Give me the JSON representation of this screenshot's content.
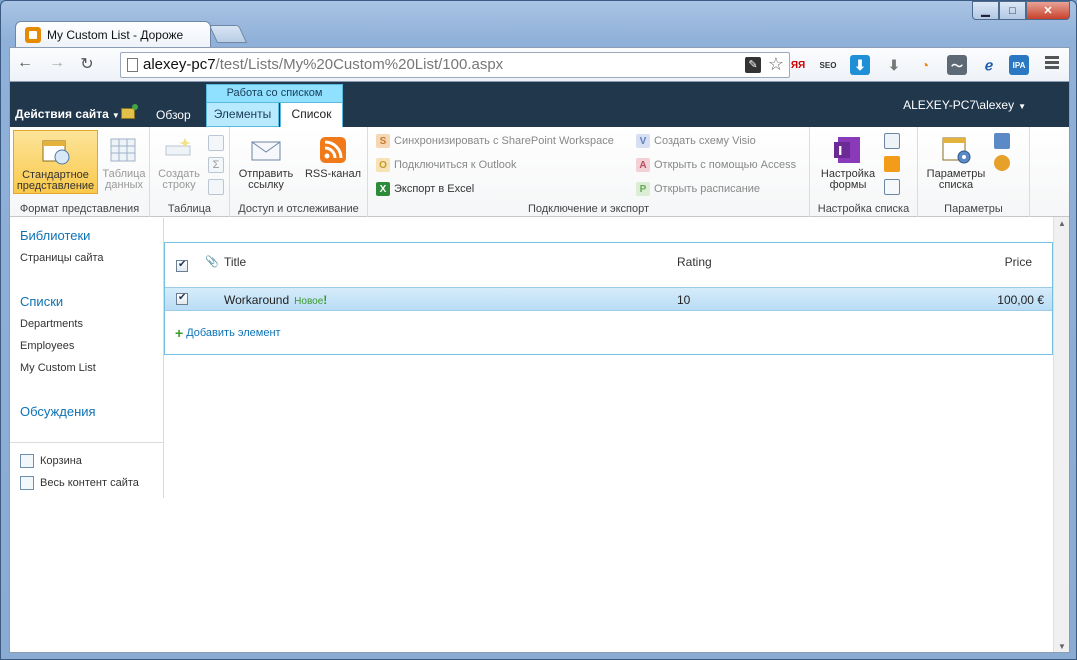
{
  "browser": {
    "tab_title": "My Custom List - Дороже",
    "url_host": "alexey-pc7",
    "url_path": "/test/Lists/My%20Custom%20List/100.aspx",
    "win_minimize": "▁",
    "win_maximize": "□",
    "win_close": "✕",
    "back": "←",
    "forward": "→",
    "reload": "↻",
    "ext_yandex": "ЯЯ",
    "ext_seo": "SEO",
    "ext_ipa": "IPA"
  },
  "topbar": {
    "site_actions": "Действия сайта",
    "browse_tab": "Обзор",
    "context_group": "Работа со списком",
    "tab_items": "Элементы",
    "tab_list": "Список",
    "user": "ALEXEY-PC7\\alexey"
  },
  "ribbon": {
    "groups": {
      "view_format": "Формат представления",
      "datasheet": "Таблица",
      "share_track": "Доступ и отслеживание",
      "connect_export": "Подключение и экспорт",
      "customize_list": "Настройка списка",
      "settings": "Параметры"
    },
    "buttons": {
      "standard_view": "Стандартное\nпредставление",
      "datasheet_view": "Таблица\nданных",
      "create_row": "Создать\nстроку",
      "email_link": "Отправить\nссылку",
      "rss_feed": "RSS-канал",
      "sync_workspace": "Синхронизировать с SharePoint Workspace",
      "connect_outlook": "Подключиться к Outlook",
      "export_excel": "Экспорт в Excel",
      "create_visio": "Создать схему Visio",
      "open_access": "Открыть с помощью Access",
      "open_schedule": "Открыть расписание",
      "customize_form": "Настройка\nформы",
      "list_settings": "Параметры\nсписка"
    }
  },
  "quicklaunch": {
    "libraries": "Библиотеки",
    "site_pages": "Страницы сайта",
    "lists": "Списки",
    "list_items": [
      "Departments",
      "Employees",
      "My Custom List"
    ],
    "discussions": "Обсуждения",
    "recycle_bin": "Корзина",
    "all_content": "Весь контент сайта"
  },
  "list": {
    "columns": {
      "title": "Title",
      "rating": "Rating",
      "price": "Price"
    },
    "rows": [
      {
        "title": "Workaround",
        "badge": "Новое",
        "rating": "10",
        "price": "100,00 €"
      }
    ],
    "add_item": "Добавить элемент"
  }
}
